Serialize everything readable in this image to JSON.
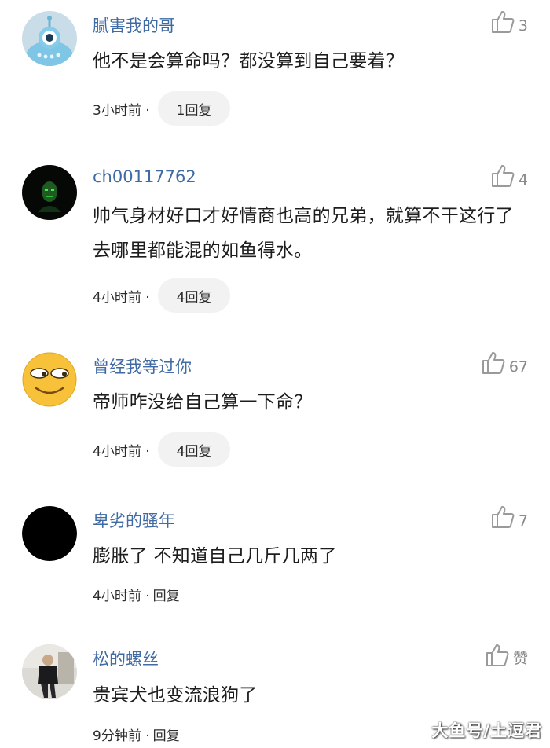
{
  "comments": [
    {
      "username": "腻害我的哥",
      "likes": "3",
      "text": "他不是会算命吗？都没算到自己要着？",
      "time": "3小时前 ·",
      "reply": "1回复"
    },
    {
      "username": "ch00117762",
      "likes": "4",
      "text": "帅气身材好口才好情商也高的兄弟，就算不干这行了去哪里都能混的如鱼得水。",
      "time": "4小时前 ·",
      "reply": "4回复"
    },
    {
      "username": "曾经我等过你",
      "likes": "67",
      "text": "帝师咋没给自己算一下命？",
      "time": "4小时前 ·",
      "reply": "4回复"
    },
    {
      "username": "卑劣的骚年",
      "likes": "7",
      "text": "膨胀了 不知道自己几斤几两了",
      "time": "4小时前 ·",
      "reply": "回复"
    },
    {
      "username": "松的螺丝",
      "likes": "赞",
      "text": "贵宾犬也变流浪狗了",
      "time": "9分钟前 ·",
      "reply": "回复"
    }
  ],
  "icons": {
    "like": "thumbs-up-icon"
  },
  "watermark": "大鱼号/土逗君"
}
